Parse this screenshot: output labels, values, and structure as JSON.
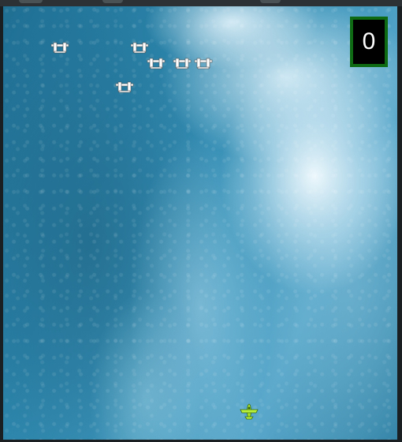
{
  "game": {
    "score": "0",
    "icons": {
      "enemy": "enemy-plane-icon",
      "player": "player-plane-icon"
    },
    "colors": {
      "score_border": "#0e6b13",
      "player": "#a6e22e",
      "enemy": "#ffffff"
    }
  }
}
